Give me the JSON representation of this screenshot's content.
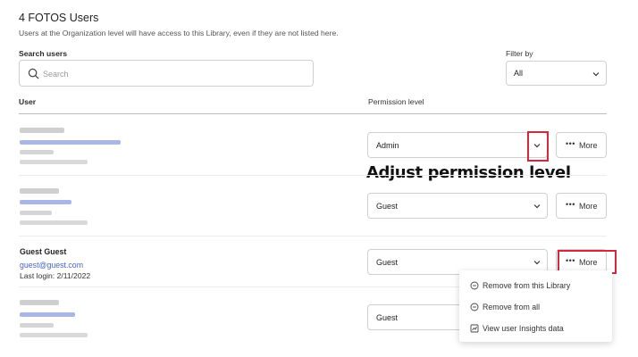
{
  "header": {
    "title": "4 FOTOS Users",
    "subtitle": "Users at the Organization level will have access to this Library, even if they are not listed here."
  },
  "search": {
    "label": "Search users",
    "placeholder": "Search"
  },
  "filter": {
    "label": "Filter by",
    "value": "All"
  },
  "table": {
    "col_user": "User",
    "col_permission": "Permission level"
  },
  "rows": [
    {
      "permission": "Admin",
      "more_label": "More"
    },
    {
      "permission": "Guest",
      "more_label": "More"
    },
    {
      "name": "Guest Guest",
      "email": "guest@guest.com",
      "last_login": "Last login: 2/11/2022",
      "permission": "Guest",
      "more_label": "More"
    },
    {
      "permission": "Guest"
    }
  ],
  "annotation": "Adjust permission level",
  "more_menu": {
    "items": [
      "Remove from this Library",
      "Remove from all",
      "View user Insights data"
    ]
  },
  "colors": {
    "highlight": "#d8263c",
    "link": "#4a63c9"
  },
  "icons": [
    "search-icon",
    "chevron-down-icon",
    "more-dots-icon",
    "minus-circle-icon",
    "chart-icon"
  ]
}
